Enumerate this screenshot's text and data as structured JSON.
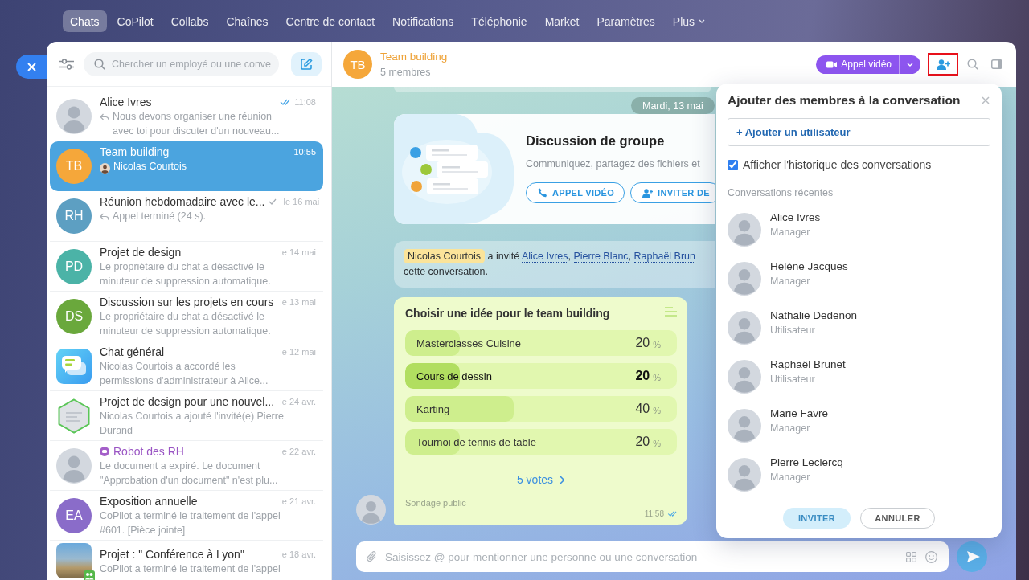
{
  "nav": {
    "items": [
      {
        "label": "Chats",
        "selected": true
      },
      {
        "label": "CoPilot",
        "selected": false
      },
      {
        "label": "Collabs",
        "selected": false
      },
      {
        "label": "Chaînes",
        "selected": false
      },
      {
        "label": "Centre de contact",
        "selected": false
      },
      {
        "label": "Notifications",
        "selected": false
      },
      {
        "label": "Téléphonie",
        "selected": false
      },
      {
        "label": "Market",
        "selected": false
      },
      {
        "label": "Paramètres",
        "selected": false
      }
    ],
    "more": "Plus"
  },
  "sidebar": {
    "search": {
      "placeholder": "Chercher un employé ou une conve"
    },
    "chats": [
      {
        "title": "Alice Ivres",
        "time": "11:08",
        "preview": "Nous devons organiser une réunion avec toi pour discuter d'un nouveau...",
        "avatar": {
          "kind": "photo"
        },
        "reply": true,
        "sender_avatar": false,
        "delivered": true,
        "read": true,
        "bot": false,
        "selected": false
      },
      {
        "title": "Team building",
        "time": "10:55",
        "preview": "Nicolas Courtois",
        "avatar": {
          "kind": "initials",
          "initials": "TB",
          "color": "#f5a73a"
        },
        "reply": false,
        "sender_avatar": true,
        "delivered": false,
        "read": false,
        "bot": false,
        "selected": true
      },
      {
        "title": "Réunion hebdomadaire avec le...",
        "time": "le 16 mai",
        "preview": "Appel terminé (24 s).",
        "avatar": {
          "kind": "initials",
          "initials": "RH",
          "color": "#5d9fc2"
        },
        "reply": true,
        "sender_avatar": false,
        "delivered": true,
        "read": false,
        "bot": false,
        "selected": false
      },
      {
        "title": "Projet de design",
        "time": "le 14 mai",
        "preview": "Le propriétaire du chat a désactivé le minuteur de suppression automatique.",
        "avatar": {
          "kind": "initials",
          "initials": "PD",
          "color": "#4bb3a7"
        },
        "reply": false,
        "sender_avatar": false,
        "delivered": false,
        "read": false,
        "bot": false,
        "selected": false
      },
      {
        "title": "Discussion sur les projets en cours",
        "time": "le 13 mai",
        "preview": "Le propriétaire du chat a désactivé le minuteur de suppression automatique.",
        "avatar": {
          "kind": "initials",
          "initials": "DS",
          "color": "#6aa83c"
        },
        "reply": false,
        "sender_avatar": false,
        "delivered": false,
        "read": false,
        "bot": false,
        "selected": false
      },
      {
        "title": "Chat général",
        "time": "le 12 mai",
        "preview": "Nicolas Courtois a accordé les permissions d'administrateur à Alice...",
        "avatar": {
          "kind": "app"
        },
        "reply": false,
        "sender_avatar": false,
        "delivered": false,
        "read": false,
        "bot": false,
        "selected": false
      },
      {
        "title": "Projet de design pour une nouvel...",
        "time": "le 24 avr.",
        "preview": "Nicolas Courtois a ajouté l'invité(e) Pierre Durand",
        "avatar": {
          "kind": "hex-photo"
        },
        "reply": false,
        "sender_avatar": false,
        "delivered": false,
        "read": false,
        "bot": false,
        "selected": false
      },
      {
        "title": "Robot des RH",
        "time": "le 22 avr.",
        "preview": "Le document a expiré. Le document \"Approbation d'un document\" n'est plu...",
        "avatar": {
          "kind": "photo"
        },
        "reply": false,
        "sender_avatar": false,
        "delivered": false,
        "read": false,
        "bot": true,
        "selected": false
      },
      {
        "title": "Exposition annuelle",
        "time": "le 21 avr.",
        "preview": "CoPilot a terminé le traitement de l'appel #601. [Pièce jointe]",
        "avatar": {
          "kind": "initials",
          "initials": "EA",
          "color": "#8a6cc9"
        },
        "reply": false,
        "sender_avatar": false,
        "delivered": false,
        "read": false,
        "bot": false,
        "selected": false
      },
      {
        "title": "Projet : \" Conférence à Lyon\"",
        "time": "le 18 avr.",
        "preview": "CoPilot a terminé le traitement de l'appel",
        "avatar": {
          "kind": "square-photo"
        },
        "reply": false,
        "sender_avatar": false,
        "delivered": false,
        "read": false,
        "bot": false,
        "selected": false
      }
    ]
  },
  "chat": {
    "avatar": "TB",
    "title": "Team building",
    "subtitle": "5 membres",
    "call_button": "Appel vidéo",
    "header_actions": [
      {
        "kind": "add-user",
        "highlighted": true
      },
      {
        "kind": "search",
        "highlighted": false
      },
      {
        "kind": "sidebar",
        "highlighted": false
      }
    ],
    "date": "Mardi, 13 mai",
    "intro_card": {
      "title": "Discussion de groupe",
      "text": "Communiquez, partagez des fichiers et",
      "buttons": [
        {
          "kind": "call",
          "label": "APPEL VIDÉO"
        },
        {
          "kind": "invite",
          "label": "INVITER DE"
        }
      ]
    },
    "system_message": [
      {
        "kind": "mention",
        "text": "Nicolas Courtois"
      },
      {
        "kind": "text",
        "text": " a invité "
      },
      {
        "kind": "link",
        "text": "Alice Ivres"
      },
      {
        "kind": "text",
        "text": ", "
      },
      {
        "kind": "link",
        "text": "Pierre Blanc"
      },
      {
        "kind": "text",
        "text": ", "
      },
      {
        "kind": "link",
        "text": "Raphaël Brun"
      },
      {
        "kind": "break"
      },
      {
        "kind": "text",
        "text": "cette conversation."
      }
    ],
    "poll": {
      "title": "Choisir une idée pour le team building",
      "options": [
        {
          "label": "Masterclasses Cuisine",
          "percent": "20",
          "unit": "%",
          "level": 0.2,
          "selected": false
        },
        {
          "label": "Cours de dessin",
          "percent": "20",
          "unit": "%",
          "level": 0.2,
          "selected": true
        },
        {
          "label": "Karting",
          "percent": "40",
          "unit": "%",
          "level": 0.4,
          "selected": false
        },
        {
          "label": "Tournoi de tennis de table",
          "percent": "20",
          "unit": "%",
          "level": 0.2,
          "selected": false
        }
      ],
      "votes": "5 votes",
      "footer": "Sondage public",
      "time": "11:58"
    },
    "composer": {
      "placeholder": "Saisissez @ pour mentionner une personne ou une conversation"
    }
  },
  "add_members": {
    "title": "Ajouter des membres à la conversation",
    "add_user": "+ Ajouter un utilisateur",
    "show_history": {
      "label": "Afficher l'historique des conversations",
      "checked": true
    },
    "recent_label": "Conversations récentes",
    "people": [
      {
        "name": "Alice Ivres",
        "role": "Manager"
      },
      {
        "name": "Hélène Jacques",
        "role": "Manager"
      },
      {
        "name": "Nathalie Dedenon",
        "role": "Utilisateur"
      },
      {
        "name": "Raphaël Brunet",
        "role": "Utilisateur"
      },
      {
        "name": "Marie Favre",
        "role": "Manager"
      },
      {
        "name": "Pierre Leclercq",
        "role": "Manager"
      }
    ],
    "buttons": [
      {
        "kind": "primary",
        "label": "INVITER",
        "disabled": true
      },
      {
        "kind": "secondary",
        "label": "ANNULER",
        "disabled": false
      }
    ]
  }
}
